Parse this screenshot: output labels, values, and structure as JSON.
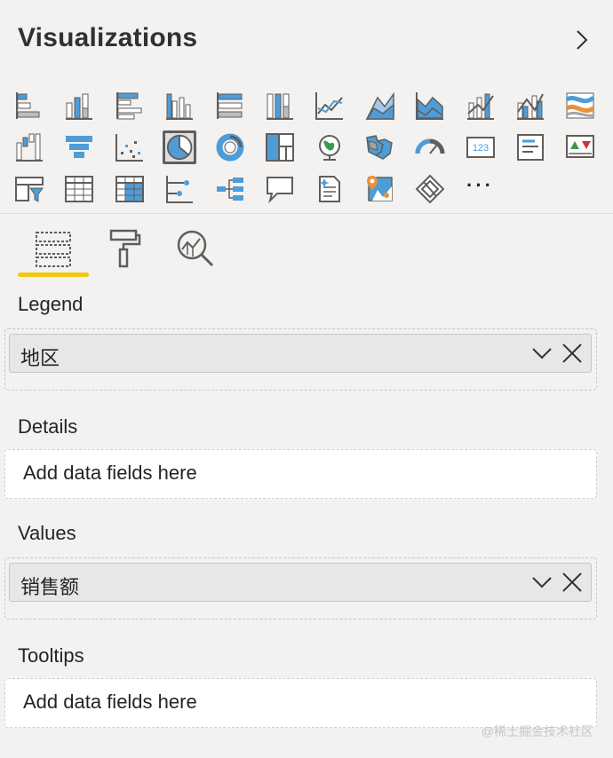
{
  "header": {
    "title": "Visualizations"
  },
  "visual_rows": [
    [
      "stacked-bar-chart-icon",
      "stacked-column-chart-icon",
      "clustered-bar-chart-icon",
      "clustered-column-chart-icon",
      "100-percent-stacked-bar-chart-icon",
      "100-percent-stacked-column-chart-icon",
      "line-chart-icon",
      "area-chart-icon",
      "stacked-area-chart-icon",
      "line-and-stacked-column-chart-icon",
      "line-and-clustered-column-chart-icon",
      "ribbon-chart-icon"
    ],
    [
      "waterfall-chart-icon",
      "funnel-icon",
      "scatter-chart-icon",
      "pie-chart-icon",
      "donut-chart-icon",
      "treemap-icon",
      "map-icon",
      "filled-map-icon",
      "gauge-icon",
      "card-icon",
      "multi-row-card-icon",
      "kpi-icon"
    ],
    [
      "slicer-icon",
      "table-icon",
      "matrix-icon",
      "key-influencers-icon",
      "decomposition-tree-icon",
      "qa-icon",
      "smart-narrative-icon",
      "arcgis-map-icon",
      "power-apps-icon",
      "more-visuals-icon"
    ]
  ],
  "more_visuals": {
    "label": "···"
  },
  "pane_tabs": [
    "fields-tab-icon",
    "format-tab-icon",
    "analytics-tab-icon"
  ],
  "wells": {
    "legend": {
      "label": "Legend",
      "field": "地区"
    },
    "details": {
      "label": "Details",
      "placeholder": "Add data fields here"
    },
    "values": {
      "label": "Values",
      "field": "销售额"
    },
    "tooltips": {
      "label": "Tooltips",
      "placeholder": "Add data fields here"
    }
  },
  "watermark": "@稀土掘金技术社区",
  "colors": {
    "accent": "#f2c811",
    "icon_blue": "#4e9cd8",
    "icon_gray": "#605e5c",
    "background": "#f3f2f1"
  }
}
